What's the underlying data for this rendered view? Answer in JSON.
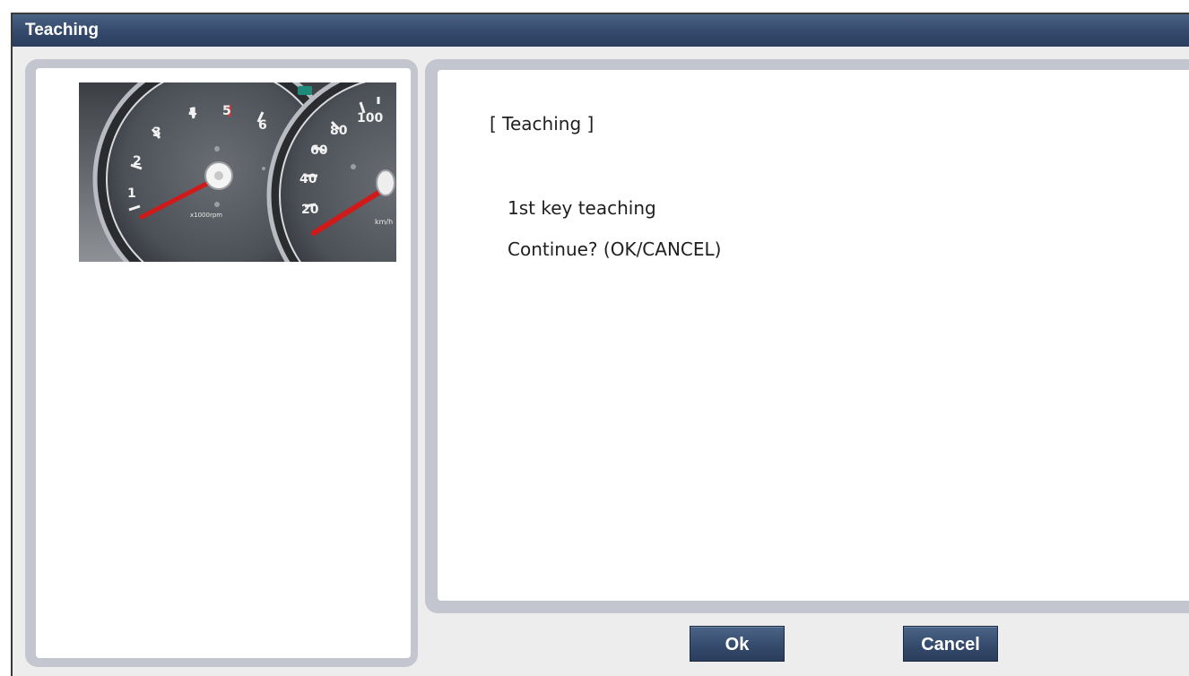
{
  "window": {
    "title": "Teaching"
  },
  "illustration": {
    "icon": "instrument-cluster-gauge-icon",
    "tachometer_ticks": [
      "1",
      "2",
      "3",
      "4",
      "5",
      "6"
    ],
    "tachometer_unit": "x1000rpm",
    "speedometer_ticks": [
      "20",
      "40",
      "60",
      "80",
      "100"
    ],
    "speedometer_unit": "km/h"
  },
  "message": {
    "heading": "[ Teaching ]",
    "line1": "1st key teaching",
    "line2": "Continue? (OK/CANCEL)"
  },
  "buttons": {
    "ok_label": "Ok",
    "cancel_label": "Cancel"
  },
  "colors": {
    "titlebar": "#34496b",
    "button": "#34496b",
    "panel_frame": "#c3c6ce",
    "needle": "#d01a1a"
  }
}
